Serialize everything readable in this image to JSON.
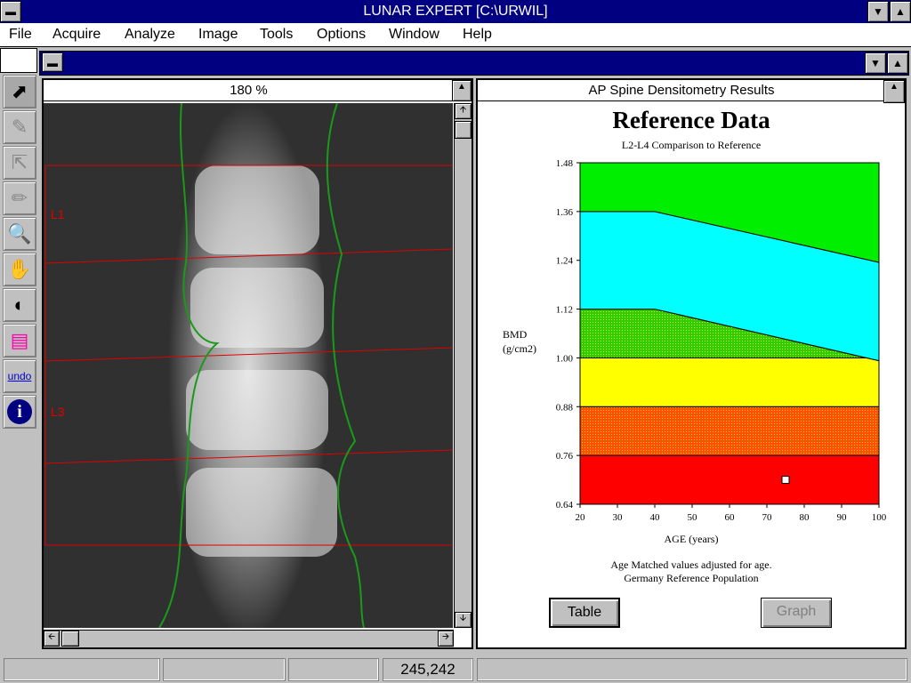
{
  "app": {
    "title": "LUNAR EXPERT [C:\\URWIL]"
  },
  "menu": [
    "File",
    "Acquire",
    "Analyze",
    "Image",
    "Tools",
    "Options",
    "Window",
    "Help"
  ],
  "toolbar": [
    "pointer-icon",
    "edit-roi-icon",
    "select-region-icon",
    "point-typing-icon",
    "zoom-out-icon",
    "hand-pan-icon",
    "contrast-icon",
    "color-palette-icon",
    "undo-icon",
    "info-icon"
  ],
  "image_pane": {
    "zoom": "180 %",
    "labels": [
      "L1",
      "L3"
    ]
  },
  "results_pane": {
    "title": "AP Spine Densitometry Results",
    "footnote1": "Age Matched values adjusted for age.",
    "footnote2": "Germany Reference Population",
    "table_button": "Table",
    "graph_button": "Graph"
  },
  "status": {
    "coords": "245,242"
  },
  "chart_data": {
    "type": "area",
    "title": "Reference Data",
    "subtitle": "L2-L4 Comparison to Reference",
    "xlabel": "AGE (years)",
    "ylabel": "BMD\n(g/cm2)",
    "xlim": [
      20,
      100
    ],
    "ylim": [
      0.64,
      1.48
    ],
    "xticks": [
      20,
      30,
      40,
      50,
      60,
      70,
      80,
      90,
      100
    ],
    "yticks": [
      "0.64",
      "0.76",
      "0.88",
      "1.00",
      "1.12",
      "1.24",
      "1.36",
      "1.48"
    ],
    "bands": [
      {
        "color": "#ff0000",
        "lower": [
          [
            20,
            0.64
          ],
          [
            100,
            0.64
          ]
        ],
        "upper": [
          [
            20,
            0.76
          ],
          [
            100,
            0.76
          ]
        ]
      },
      {
        "color": "#e87800",
        "hatched": true,
        "lower": [
          [
            20,
            0.76
          ],
          [
            100,
            0.76
          ]
        ],
        "upper": [
          [
            20,
            0.88
          ],
          [
            100,
            0.88
          ]
        ]
      },
      {
        "color": "#ffff00",
        "lower": [
          [
            20,
            0.88
          ],
          [
            100,
            0.88
          ]
        ],
        "upper": [
          [
            20,
            1.0
          ],
          [
            100,
            1.0
          ]
        ]
      },
      {
        "color": "#66dd00",
        "hatched": true,
        "lower": [
          [
            20,
            1.0
          ],
          [
            100,
            1.0
          ]
        ],
        "upper": [
          [
            20,
            1.12
          ],
          [
            40,
            1.12
          ],
          [
            100,
            0.993
          ]
        ]
      },
      {
        "color": "#00ffff",
        "lower": [
          [
            20,
            1.12
          ],
          [
            40,
            1.12
          ],
          [
            100,
            0.993
          ]
        ],
        "upper": [
          [
            20,
            1.36
          ],
          [
            40,
            1.36
          ],
          [
            100,
            1.235
          ]
        ]
      },
      {
        "color": "#00ee00",
        "lower": [
          [
            20,
            1.36
          ],
          [
            40,
            1.36
          ],
          [
            100,
            1.235
          ]
        ],
        "upper": [
          [
            20,
            1.48
          ],
          [
            100,
            1.48
          ]
        ]
      }
    ],
    "points": [
      {
        "x": 75,
        "y": 0.7
      }
    ],
    "grid": false
  }
}
